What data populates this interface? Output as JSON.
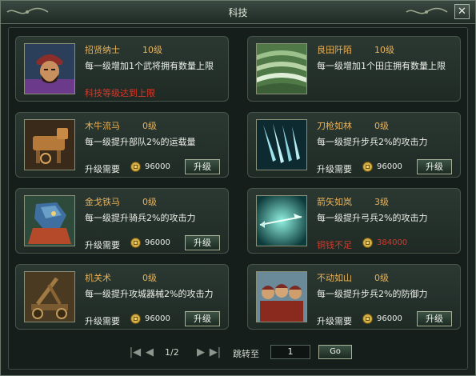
{
  "window": {
    "title": "科技",
    "close_icon": "close-icon"
  },
  "cards": [
    {
      "name": "招贤纳士",
      "level": "10级",
      "desc": "每一级增加1个武将拥有数量上限",
      "status": "科技等级达到上限",
      "icon": "general-portrait"
    },
    {
      "name": "良田阡陌",
      "level": "10级",
      "desc": "每一级增加1个田庄拥有数量上限",
      "icon": "terraced-field"
    },
    {
      "name": "木牛流马",
      "level": "0级",
      "desc": "每一级提升部队2%的运载量",
      "cost_label": "升级需要",
      "cost": "96000",
      "button": "升级",
      "icon": "wooden-ox"
    },
    {
      "name": "刀枪如林",
      "level": "0级",
      "desc": "每一级提升步兵2%的攻击力",
      "cost_label": "升级需要",
      "cost": "96000",
      "button": "升级",
      "icon": "blades"
    },
    {
      "name": "金戈铁马",
      "level": "0级",
      "desc": "每一级提升骑兵2%的攻击力",
      "cost_label": "升级需要",
      "cost": "96000",
      "button": "升级",
      "icon": "armored-horse"
    },
    {
      "name": "箭矢如岚",
      "level": "3级",
      "desc": "每一级提升弓兵2%的攻击力",
      "cost_label": "铜钱不足",
      "cost": "384000",
      "icon": "arrow"
    },
    {
      "name": "机关术",
      "level": "0级",
      "desc": "每一级提升攻城器械2%的攻击力",
      "cost_label": "升级需要",
      "cost": "96000",
      "button": "升级",
      "icon": "catapult"
    },
    {
      "name": "不动如山",
      "level": "0级",
      "desc": "每一级提升步兵2%的防御力",
      "cost_label": "升级需要",
      "cost": "96000",
      "button": "升级",
      "icon": "soldiers"
    }
  ],
  "pager": {
    "page": "1/2",
    "jump_label": "跳转至",
    "input_value": "1",
    "go": "Go"
  },
  "colors": {
    "accent": "#e9b25a",
    "warning": "#d43a2a",
    "panel": "#1f2a25"
  }
}
